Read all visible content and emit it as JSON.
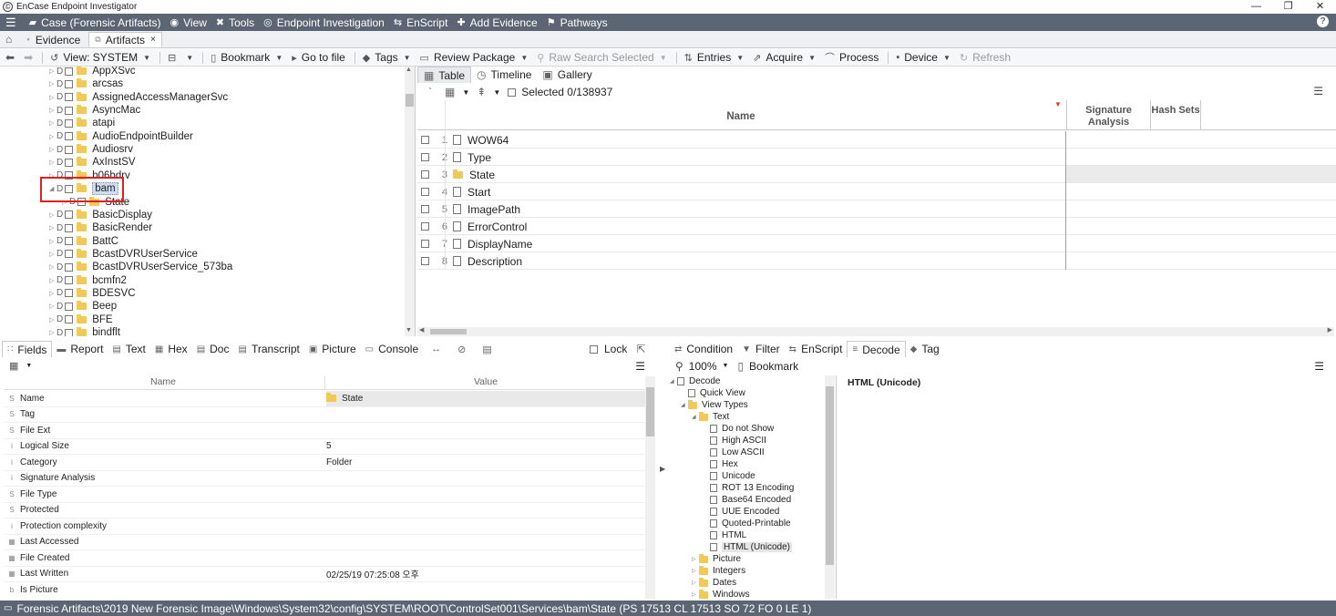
{
  "window": {
    "title": "EnCase Endpoint Investigator",
    "buttons": [
      "—",
      "❐",
      "✕"
    ]
  },
  "menubar": {
    "items": [
      {
        "icon": "briefcase-icon",
        "glyph": "▰",
        "label": "Case (Forensic Artifacts)"
      },
      {
        "icon": "eye-icon",
        "glyph": "◉",
        "label": "View"
      },
      {
        "icon": "wrench-icon",
        "glyph": "✖",
        "label": "Tools"
      },
      {
        "icon": "globe-icon",
        "glyph": "◎",
        "label": "Endpoint Investigation"
      },
      {
        "icon": "script-icon",
        "glyph": "⇆",
        "label": "EnScript"
      },
      {
        "icon": "add-evidence-icon",
        "glyph": "✚",
        "label": "Add Evidence"
      },
      {
        "icon": "pathways-icon",
        "glyph": "⚑",
        "label": "Pathways"
      }
    ],
    "help": "?"
  },
  "tabs": [
    {
      "label": "Evidence",
      "active": false
    },
    {
      "label": "Artifacts",
      "active": true,
      "close": "×"
    }
  ],
  "toolbar": {
    "view": "View: SYSTEM",
    "bookmark": "Bookmark",
    "goto": "Go to file",
    "tags": "Tags",
    "review": "Review Package",
    "rawsearch": "Raw Search Selected",
    "entries": "Entries",
    "acquire": "Acquire",
    "process": "Process",
    "device": "Device",
    "refresh": "Refresh"
  },
  "tree": {
    "items": [
      {
        "label": "AppXSvc"
      },
      {
        "label": "arcsas"
      },
      {
        "label": "AssignedAccessManagerSvc"
      },
      {
        "label": "AsyncMac"
      },
      {
        "label": "atapi"
      },
      {
        "label": "AudioEndpointBuilder"
      },
      {
        "label": "Audiosrv"
      },
      {
        "label": "AxInstSV"
      },
      {
        "label": "b06bdrv"
      },
      {
        "label": "bam",
        "selected": true
      },
      {
        "label": "State",
        "child": true
      },
      {
        "label": "BasicDisplay"
      },
      {
        "label": "BasicRender"
      },
      {
        "label": "BattC"
      },
      {
        "label": "BcastDVRUserService"
      },
      {
        "label": "BcastDVRUserService_573ba"
      },
      {
        "label": "bcmfn2"
      },
      {
        "label": "BDESVC"
      },
      {
        "label": "Beep"
      },
      {
        "label": "BFE"
      },
      {
        "label": "bindflt"
      }
    ]
  },
  "tablepane": {
    "tabs": [
      "Table",
      "Timeline",
      "Gallery"
    ],
    "selected": "Selected 0/138937",
    "columns": {
      "name": "Name",
      "signature": "Signature Analysis",
      "hash": "Hash Sets"
    },
    "rows": [
      {
        "n": "1",
        "name": "WOW64",
        "type": "file"
      },
      {
        "n": "2",
        "name": "Type",
        "type": "file"
      },
      {
        "n": "3",
        "name": "State",
        "type": "folder"
      },
      {
        "n": "4",
        "name": "Start",
        "type": "file"
      },
      {
        "n": "5",
        "name": "ImagePath",
        "type": "file"
      },
      {
        "n": "6",
        "name": "ErrorControl",
        "type": "file"
      },
      {
        "n": "7",
        "name": "DisplayName",
        "type": "file"
      },
      {
        "n": "8",
        "name": "Description",
        "type": "file"
      }
    ]
  },
  "bottomleft": {
    "tabs": [
      "Fields",
      "Report",
      "Text",
      "Hex",
      "Doc",
      "Transcript",
      "Picture",
      "Console"
    ],
    "lock": "Lock",
    "columns": {
      "name": "Name",
      "value": "Value"
    },
    "fields": [
      {
        "t": "S",
        "name": "Name",
        "value": "State",
        "folder": true
      },
      {
        "t": "S",
        "name": "Tag",
        "value": ""
      },
      {
        "t": "S",
        "name": "File Ext",
        "value": ""
      },
      {
        "t": "i",
        "name": "Logical Size",
        "value": "5"
      },
      {
        "t": "i",
        "name": "Category",
        "value": "Folder"
      },
      {
        "t": "i",
        "name": "Signature Analysis",
        "value": ""
      },
      {
        "t": "S",
        "name": "File Type",
        "value": ""
      },
      {
        "t": "S",
        "name": "Protected",
        "value": ""
      },
      {
        "t": "i",
        "name": "Protection complexity",
        "value": ""
      },
      {
        "t": "▦",
        "name": "Last Accessed",
        "value": ""
      },
      {
        "t": "▦",
        "name": "File Created",
        "value": ""
      },
      {
        "t": "▦",
        "name": "Last Written",
        "value": "02/25/19 07:25:08 오후"
      },
      {
        "t": "b",
        "name": "Is Picture",
        "value": ""
      }
    ]
  },
  "bottomright": {
    "tabs": [
      "Condition",
      "Filter",
      "EnScript",
      "Decode",
      "Tag"
    ],
    "zoom": "100%",
    "bookmark": "Bookmark",
    "decode_tree": [
      {
        "label": "Decode",
        "lvl": 0,
        "kind": "file"
      },
      {
        "label": "Quick View",
        "lvl": 1,
        "kind": "file"
      },
      {
        "label": "View Types",
        "lvl": 1,
        "kind": "folder"
      },
      {
        "label": "Text",
        "lvl": 2,
        "kind": "folder"
      },
      {
        "label": "Do not Show",
        "lvl": 3,
        "kind": "file"
      },
      {
        "label": "High ASCII",
        "lvl": 3,
        "kind": "file"
      },
      {
        "label": "Low ASCII",
        "lvl": 3,
        "kind": "file"
      },
      {
        "label": "Hex",
        "lvl": 3,
        "kind": "file"
      },
      {
        "label": "Unicode",
        "lvl": 3,
        "kind": "file"
      },
      {
        "label": "ROT 13 Encoding",
        "lvl": 3,
        "kind": "file"
      },
      {
        "label": "Base64 Encoded",
        "lvl": 3,
        "kind": "file"
      },
      {
        "label": "UUE Encoded",
        "lvl": 3,
        "kind": "file"
      },
      {
        "label": "Quoted-Printable",
        "lvl": 3,
        "kind": "file"
      },
      {
        "label": "HTML",
        "lvl": 3,
        "kind": "file"
      },
      {
        "label": "HTML (Unicode)",
        "lvl": 3,
        "kind": "file",
        "selected": true
      },
      {
        "label": "Picture",
        "lvl": 2,
        "kind": "folder"
      },
      {
        "label": "Integers",
        "lvl": 2,
        "kind": "folder"
      },
      {
        "label": "Dates",
        "lvl": 2,
        "kind": "folder"
      },
      {
        "label": "Windows",
        "lvl": 2,
        "kind": "folder"
      }
    ],
    "preview_title": "HTML (Unicode)"
  },
  "statusbar": {
    "path": "Forensic Artifacts\\2019 New Forensic Image\\Windows\\System32\\config\\SYSTEM\\ROOT\\ControlSet001\\Services\\bam\\State (PS 17513 CL 17513 SO 72 FO 0 LE 1)"
  }
}
